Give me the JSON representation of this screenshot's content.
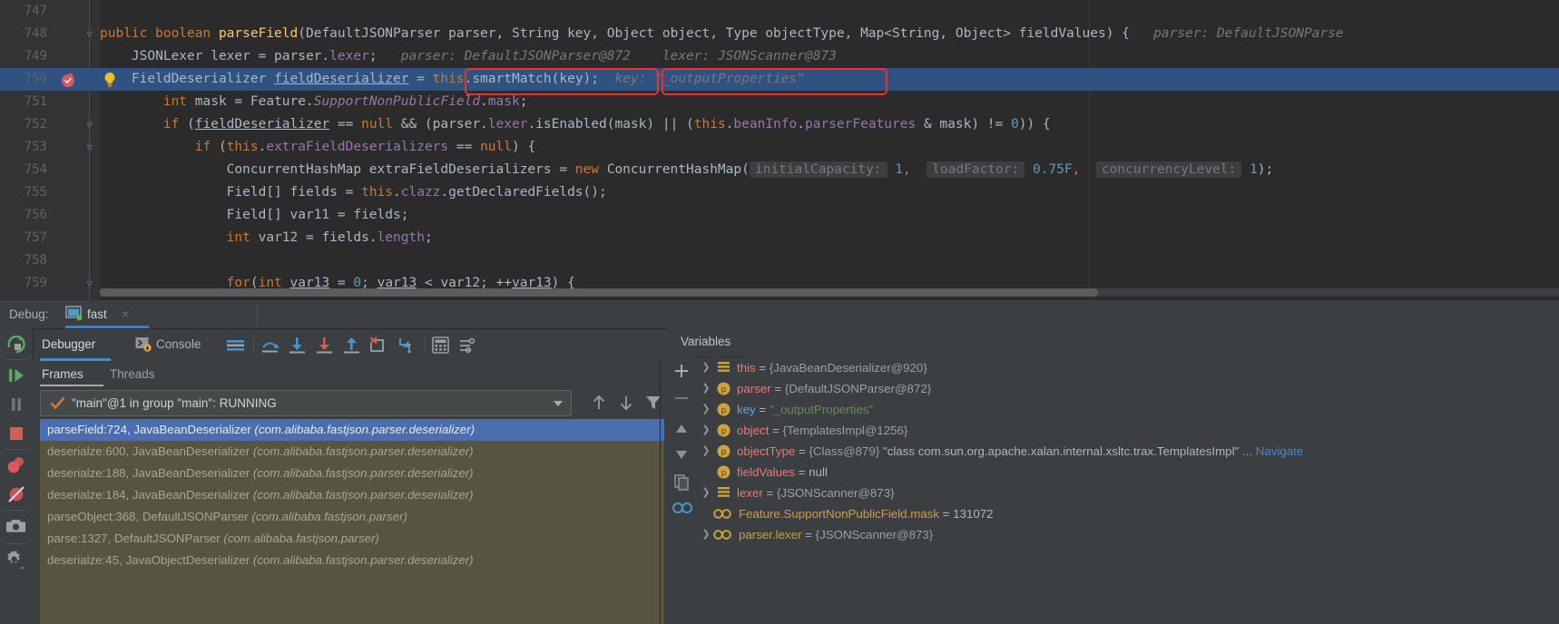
{
  "editor": {
    "margin_guide_x": 1200,
    "lines": [
      {
        "num": "747",
        "fold": "",
        "html": ""
      },
      {
        "num": "748",
        "fold": "minus",
        "indent": 0
      },
      {
        "num": "749",
        "fold": "",
        "indent": 0
      },
      {
        "num": "750",
        "fold": "",
        "indent": 0
      },
      {
        "num": "751",
        "fold": "",
        "indent": 0
      },
      {
        "num": "752",
        "fold": "minus",
        "indent": 0
      },
      {
        "num": "753",
        "fold": "minus",
        "indent": 0
      },
      {
        "num": "754",
        "fold": "",
        "indent": 0
      },
      {
        "num": "755",
        "fold": "",
        "indent": 0
      },
      {
        "num": "756",
        "fold": "",
        "indent": 0
      },
      {
        "num": "757",
        "fold": "",
        "indent": 0
      },
      {
        "num": "758",
        "fold": "",
        "indent": 0
      },
      {
        "num": "759",
        "fold": "minus",
        "indent": 0
      }
    ],
    "line_numbers": [
      "747",
      "748",
      "749",
      "750",
      "751",
      "752",
      "753",
      "754",
      "755",
      "756",
      "757",
      "758",
      "759"
    ],
    "code": {
      "l748": "public boolean parseField(DefaultJSONParser parser, String key, Object object, Type objectType, Map<String, Object> fieldValues) {",
      "l748_hint": "parser: DefaultJSONParse",
      "l749": "JSONLexer lexer = parser.lexer;",
      "l749_hint1": "parser: DefaultJSONParser@872",
      "l749_hint2": "lexer: JSONScanner@873",
      "l750": "FieldDeserializer fieldDeserializer = this.smartMatch(key);",
      "l750_hint": "key: \"_outputProperties\"",
      "l751": "int mask = Feature.SupportNonPublicField.mask;",
      "l752": "if (fieldDeserializer == null && (parser.lexer.isEnabled(mask) || (this.beanInfo.parserFeatures & mask) != 0)) {",
      "l753": "if (this.extraFieldDeserializers == null) {",
      "l754": "ConcurrentHashMap extraFieldDeserializers = new ConcurrentHashMap(",
      "l754_hint1": "initialCapacity: 1,",
      "l754_hint2": "loadFactor: 0.75F,",
      "l754_hint3": "concurrencyLevel: 1);",
      "l755": "Field[] fields = this.clazz.getDeclaredFields();",
      "l756": "Field[] var11 = fields;",
      "l757": "int var12 = fields.length;",
      "l759": "for(int var13 = 0; var13 < var12; ++var13) {"
    },
    "highlight_color": "#2f5280",
    "annotation_color": "#e8322a",
    "breakpoint_line": "750"
  },
  "debug_header": {
    "label": "Debug:",
    "tab_name": "fast",
    "close_label": "×",
    "tab_icon": "run-configuration-icon"
  },
  "left_strip": {
    "buttons": [
      {
        "name": "rerun-button",
        "title": "Rerun"
      },
      {
        "name": "resume-program-button",
        "title": "Resume Program"
      },
      {
        "name": "pause-program-button",
        "title": "Pause Program"
      },
      {
        "name": "stop-button",
        "title": "Stop"
      },
      {
        "name": "view-breakpoints-button",
        "title": "View Breakpoints"
      },
      {
        "name": "mute-breakpoints-button",
        "title": "Mute Breakpoints"
      },
      {
        "name": "camera-button",
        "title": "Get Thread Dump"
      },
      {
        "name": "settings-button",
        "title": "Settings"
      }
    ]
  },
  "toolbar": {
    "tab_debugger": "Debugger",
    "tab_console": "Console",
    "buttons": [
      {
        "name": "layout-settings-icon",
        "title": "Layout Settings"
      },
      {
        "name": "step-over-icon",
        "title": "Step Over"
      },
      {
        "name": "step-into-icon",
        "title": "Step Into"
      },
      {
        "name": "force-step-into-icon",
        "title": "Force Step Into"
      },
      {
        "name": "step-out-icon",
        "title": "Step Out"
      },
      {
        "name": "drop-frame-icon",
        "title": "Drop Frame"
      },
      {
        "name": "run-to-cursor-icon",
        "title": "Run to Cursor"
      },
      {
        "name": "evaluate-expression-icon",
        "title": "Evaluate Expression"
      },
      {
        "name": "settings-filter-icon",
        "title": "Settings"
      }
    ]
  },
  "frames": {
    "tab_frames": "Frames",
    "tab_threads": "Threads",
    "thread_selector": "\"main\"@1 in group \"main\": RUNNING",
    "items": [
      {
        "method": "parseField:724, JavaBeanDeserializer",
        "pkg": "(com.alibaba.fastjson.parser.deserializer)",
        "selected": true
      },
      {
        "method": "deserialze:600, JavaBeanDeserializer",
        "pkg": "(com.alibaba.fastjson.parser.deserializer)",
        "selected": false
      },
      {
        "method": "deserialze:188, JavaBeanDeserializer",
        "pkg": "(com.alibaba.fastjson.parser.deserializer)",
        "selected": false
      },
      {
        "method": "deserialze:184, JavaBeanDeserializer",
        "pkg": "(com.alibaba.fastjson.parser.deserializer)",
        "selected": false
      },
      {
        "method": "parseObject:368, DefaultJSONParser",
        "pkg": "(com.alibaba.fastjson.parser)",
        "selected": false
      },
      {
        "method": "parse:1327, DefaultJSONParser",
        "pkg": "(com.alibaba.fastjson.parser)",
        "selected": false
      },
      {
        "method": "deserialze:45, JavaObjectDeserializer",
        "pkg": "(com.alibaba.fastjson.parser.deserializer)",
        "selected": false
      }
    ],
    "buttons": [
      {
        "name": "frame-up-button",
        "title": "Up"
      },
      {
        "name": "frame-down-button",
        "title": "Down"
      },
      {
        "name": "frame-filter-button",
        "title": "Filter"
      }
    ]
  },
  "variables": {
    "title": "Variables",
    "buttons": [
      {
        "name": "add-watch-button",
        "label": "+"
      },
      {
        "name": "remove-watch-button",
        "label": "−"
      },
      {
        "name": "watch-up-button",
        "label": "▲"
      },
      {
        "name": "watch-down-button",
        "label": "▼"
      },
      {
        "name": "copy-value-button",
        "label": "copy"
      },
      {
        "name": "inline-watches-button",
        "label": "oo"
      }
    ],
    "rows": [
      {
        "twisty": true,
        "icon": "field-list-icon",
        "icon_kind": "list",
        "name": "this",
        "name_color": "red",
        "eq": " = ",
        "value": "{JavaBeanDeserializer@920}",
        "value_kind": "obj"
      },
      {
        "twisty": true,
        "icon": "parameter-icon",
        "icon_kind": "p",
        "name": "parser",
        "name_color": "red",
        "eq": " = ",
        "value": "{DefaultJSONParser@872}",
        "value_kind": "obj"
      },
      {
        "twisty": true,
        "icon": "parameter-icon",
        "icon_kind": "p",
        "name": "key",
        "name_color": "blue",
        "eq": " = ",
        "value": "\"_outputProperties\"",
        "value_kind": "str"
      },
      {
        "twisty": true,
        "icon": "parameter-icon",
        "icon_kind": "p",
        "name": "object",
        "name_color": "red",
        "eq": " = ",
        "value": "{TemplatesImpl@1256}",
        "value_kind": "obj"
      },
      {
        "twisty": true,
        "icon": "parameter-icon",
        "icon_kind": "p",
        "name": "objectType",
        "name_color": "red",
        "eq": " = ",
        "value": "{Class@879} ",
        "value_kind": "obj",
        "extra_str": "\"class com.sun.org.apache.xalan.internal.xsltc.trax.TemplatesImpl\"",
        "ellipsis": " ... ",
        "link": "Navigate"
      },
      {
        "twisty": false,
        "icon": "parameter-icon",
        "icon_kind": "p",
        "name": "fieldValues",
        "name_color": "red",
        "eq": " = ",
        "value": "null",
        "value_kind": "plain"
      },
      {
        "twisty": true,
        "icon": "field-list-icon",
        "icon_kind": "list",
        "name": "lexer",
        "name_color": "red",
        "eq": " = ",
        "value": "{JSONScanner@873}",
        "value_kind": "obj"
      },
      {
        "twisty": false,
        "icon": "watch-icon",
        "icon_kind": "oo",
        "name": "Feature.SupportNonPublicField.mask",
        "name_color": "orange",
        "eq": " = ",
        "value": "131072",
        "value_kind": "plain"
      },
      {
        "twisty": true,
        "icon": "watch-icon",
        "icon_kind": "oo",
        "name": "parser.lexer",
        "name_color": "orange",
        "eq": " = ",
        "value": "{JSONScanner@873}",
        "value_kind": "obj"
      }
    ]
  },
  "colors": {
    "editor_bg": "#2b2b2b",
    "panel_bg": "#3c3f41",
    "selection_blue": "#4b6eaf",
    "frames_bg": "#57543f",
    "accent_blue": "#4a88c7",
    "annotation_red": "#e8322a",
    "keyword_orange": "#cc7832",
    "string_green": "#6a8759",
    "field_purple": "#9876aa",
    "number_blue": "#6897bb"
  }
}
